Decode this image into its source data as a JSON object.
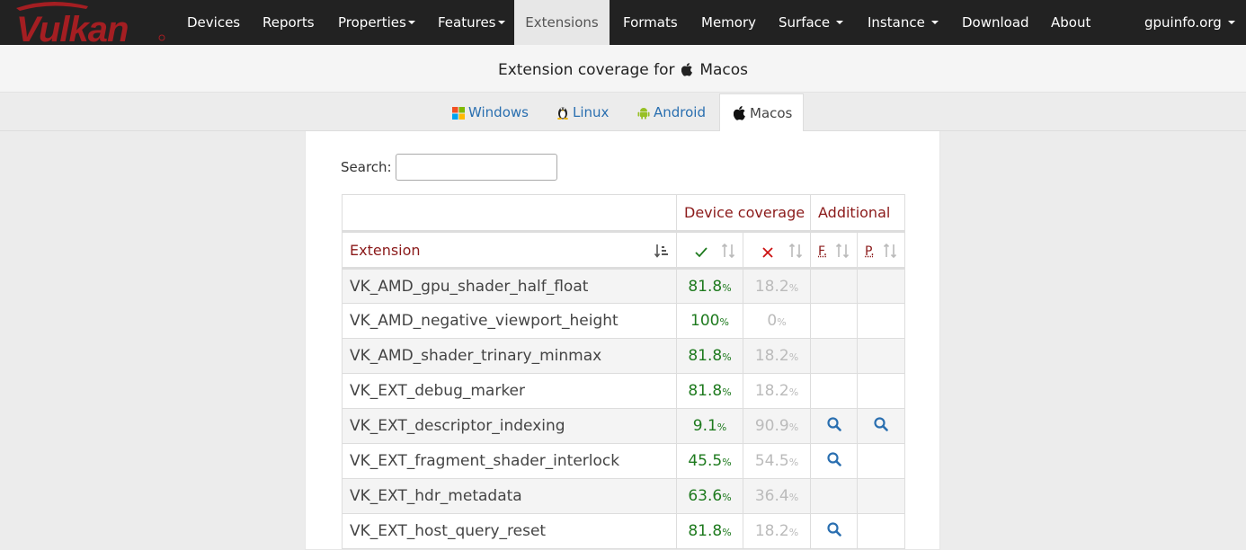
{
  "brand": "Vulkan",
  "nav": {
    "devices": "Devices",
    "reports": "Reports",
    "properties": "Properties",
    "features": "Features",
    "extensions": "Extensions",
    "formats": "Formats",
    "memory": "Memory",
    "surface": "Surface",
    "instance": "Instance",
    "download": "Download",
    "about": "About",
    "site": "gpuinfo.org"
  },
  "title": {
    "prefix": "Extension coverage for",
    "platform": "Macos"
  },
  "tabs": {
    "windows": "Windows",
    "linux": "Linux",
    "android": "Android",
    "macos": "Macos"
  },
  "search": {
    "label": "Search:",
    "value": ""
  },
  "table": {
    "group_device_coverage": "Device coverage",
    "group_additional": "Additional",
    "col_extension": "Extension",
    "col_features": "F.",
    "col_properties": "P.",
    "rows": [
      {
        "name": "VK_AMD_gpu_shader_half_float",
        "supported": "81.8",
        "unsupported": "18.2",
        "f": false,
        "p": false
      },
      {
        "name": "VK_AMD_negative_viewport_height",
        "supported": "100",
        "unsupported": "0",
        "f": false,
        "p": false
      },
      {
        "name": "VK_AMD_shader_trinary_minmax",
        "supported": "81.8",
        "unsupported": "18.2",
        "f": false,
        "p": false
      },
      {
        "name": "VK_EXT_debug_marker",
        "supported": "81.8",
        "unsupported": "18.2",
        "f": false,
        "p": false
      },
      {
        "name": "VK_EXT_descriptor_indexing",
        "supported": "9.1",
        "unsupported": "90.9",
        "f": true,
        "p": true
      },
      {
        "name": "VK_EXT_fragment_shader_interlock",
        "supported": "45.5",
        "unsupported": "54.5",
        "f": true,
        "p": false
      },
      {
        "name": "VK_EXT_hdr_metadata",
        "supported": "63.6",
        "unsupported": "36.4",
        "f": false,
        "p": false
      },
      {
        "name": "VK_EXT_host_query_reset",
        "supported": "81.8",
        "unsupported": "18.2",
        "f": true,
        "p": false
      }
    ]
  },
  "icons": {
    "tab_windows": "windows-logo-icon",
    "tab_linux": "linux-penguin-icon",
    "tab_android": "android-robot-icon",
    "tab_macos": "apple-logo-icon",
    "supported": "check-icon",
    "unsupported": "cross-icon",
    "detail": "magnifier-icon",
    "sort": "sort-icon"
  },
  "colors": {
    "navbar": "#222222",
    "brand_red": "#a41e22",
    "header_red": "#8b1a1a",
    "supported_green": "#1e7a1e",
    "unsupported_gray": "#bbbbbb",
    "link_blue": "#2a6fb0"
  }
}
